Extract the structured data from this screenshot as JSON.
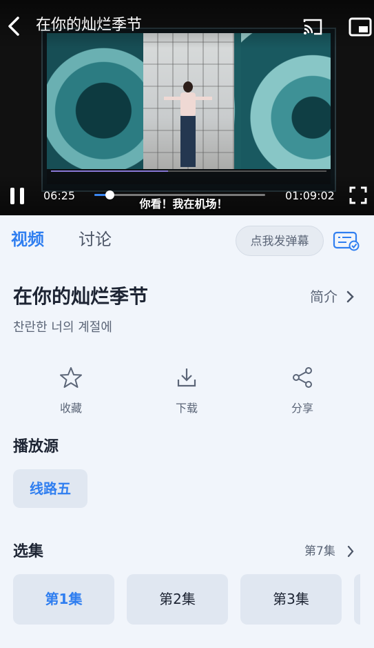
{
  "player": {
    "title": "在你的灿烂季节",
    "current_time": "06:25",
    "total_time": "01:09:02",
    "progress": 0.087,
    "subtitle": "你看！我在机场！",
    "accent": "#3a86f0",
    "icons": [
      "back-icon",
      "cast-icon",
      "pip-icon",
      "pause-icon",
      "fullscreen-icon"
    ]
  },
  "tabs": [
    {
      "label": "视频",
      "active": true
    },
    {
      "label": "讨论",
      "active": false
    }
  ],
  "danmu_button": "点我发弹幕",
  "show": {
    "title": "在你的灿烂季节",
    "original_title": "찬란한 너의 계절에",
    "intro_label": "简介"
  },
  "actions": [
    {
      "label": "收藏",
      "icon": "star-icon"
    },
    {
      "label": "下载",
      "icon": "download-icon"
    },
    {
      "label": "分享",
      "icon": "share-icon"
    }
  ],
  "source": {
    "heading": "播放源",
    "selected": "线路五"
  },
  "episodes": {
    "heading": "选集",
    "current": "第7集",
    "items": [
      {
        "label": "第1集",
        "active": true
      },
      {
        "label": "第2集",
        "active": false
      },
      {
        "label": "第3集",
        "active": false
      }
    ]
  }
}
